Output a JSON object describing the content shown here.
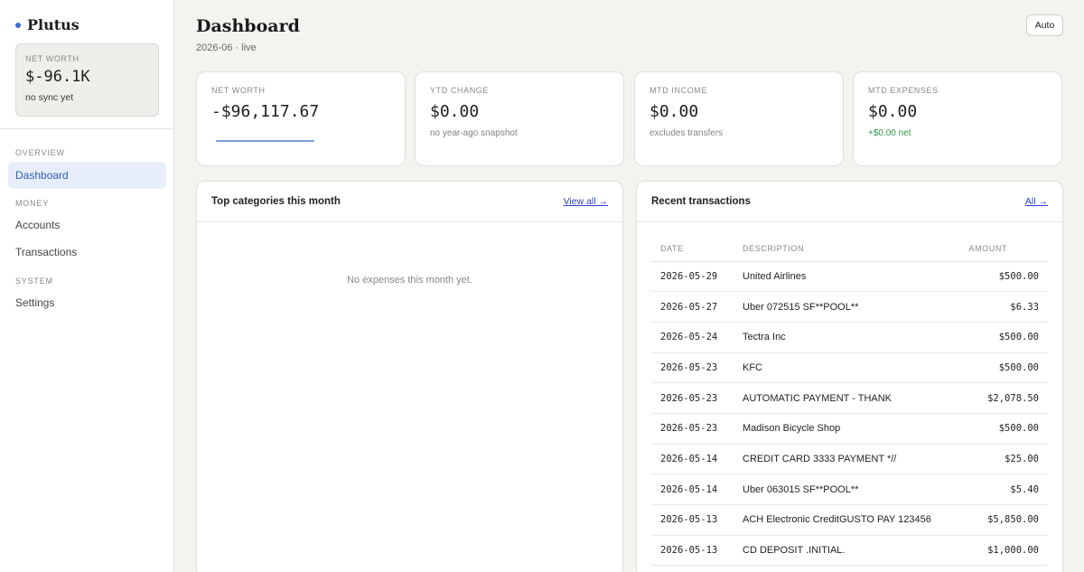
{
  "brand": {
    "name": "Plutus",
    "accent": "#3b6fd4"
  },
  "sidebar": {
    "net_worth_label": "NET WORTH",
    "net_worth_value": "$-96.1K",
    "sync_status": "no sync yet",
    "sections": {
      "overview": "OVERVIEW",
      "money": "MONEY",
      "system": "SYSTEM"
    },
    "items": {
      "dashboard": "Dashboard",
      "accounts": "Accounts",
      "transactions": "Transactions",
      "settings": "Settings"
    },
    "active_item": "Dashboard"
  },
  "header": {
    "title": "Dashboard",
    "subtitle": "2026-06 · live",
    "mode_button": "Auto"
  },
  "stats": [
    {
      "label": "NET WORTH",
      "value": "-$96,117.67",
      "sub": ""
    },
    {
      "label": "YTD CHANGE",
      "value": "$0.00",
      "sub": "no year-ago snapshot"
    },
    {
      "label": "MTD INCOME",
      "value": "$0.00",
      "sub": "excludes transfers"
    },
    {
      "label": "MTD EXPENSES",
      "value": "$0.00",
      "sub": "+$0.00 net",
      "sub_color": "#2e9a4a"
    }
  ],
  "categories_panel": {
    "title": "Top categories this month",
    "link": "View all →",
    "empty_message": "No expenses this month yet."
  },
  "transactions_panel": {
    "title": "Recent transactions",
    "link": "All →",
    "columns": [
      "DATE",
      "DESCRIPTION",
      "AMOUNT"
    ],
    "rows": [
      {
        "date": "2026-05-29",
        "description": "United Airlines",
        "amount": "$500.00"
      },
      {
        "date": "2026-05-27",
        "description": "Uber 072515 SF**POOL**",
        "amount": "$6.33"
      },
      {
        "date": "2026-05-24",
        "description": "Tectra Inc",
        "amount": "$500.00"
      },
      {
        "date": "2026-05-23",
        "description": "KFC",
        "amount": "$500.00"
      },
      {
        "date": "2026-05-23",
        "description": "AUTOMATIC PAYMENT - THANK",
        "amount": "$2,078.50"
      },
      {
        "date": "2026-05-23",
        "description": "Madison Bicycle Shop",
        "amount": "$500.00"
      },
      {
        "date": "2026-05-14",
        "description": "CREDIT CARD 3333 PAYMENT *//",
        "amount": "$25.00"
      },
      {
        "date": "2026-05-14",
        "description": "Uber 063015 SF**POOL**",
        "amount": "$5.40"
      },
      {
        "date": "2026-05-13",
        "description": "ACH Electronic CreditGUSTO PAY 123456",
        "amount": "$5,850.00"
      },
      {
        "date": "2026-05-13",
        "description": "CD DEPOSIT .INITIAL.",
        "amount": "$1,000.00"
      }
    ]
  }
}
